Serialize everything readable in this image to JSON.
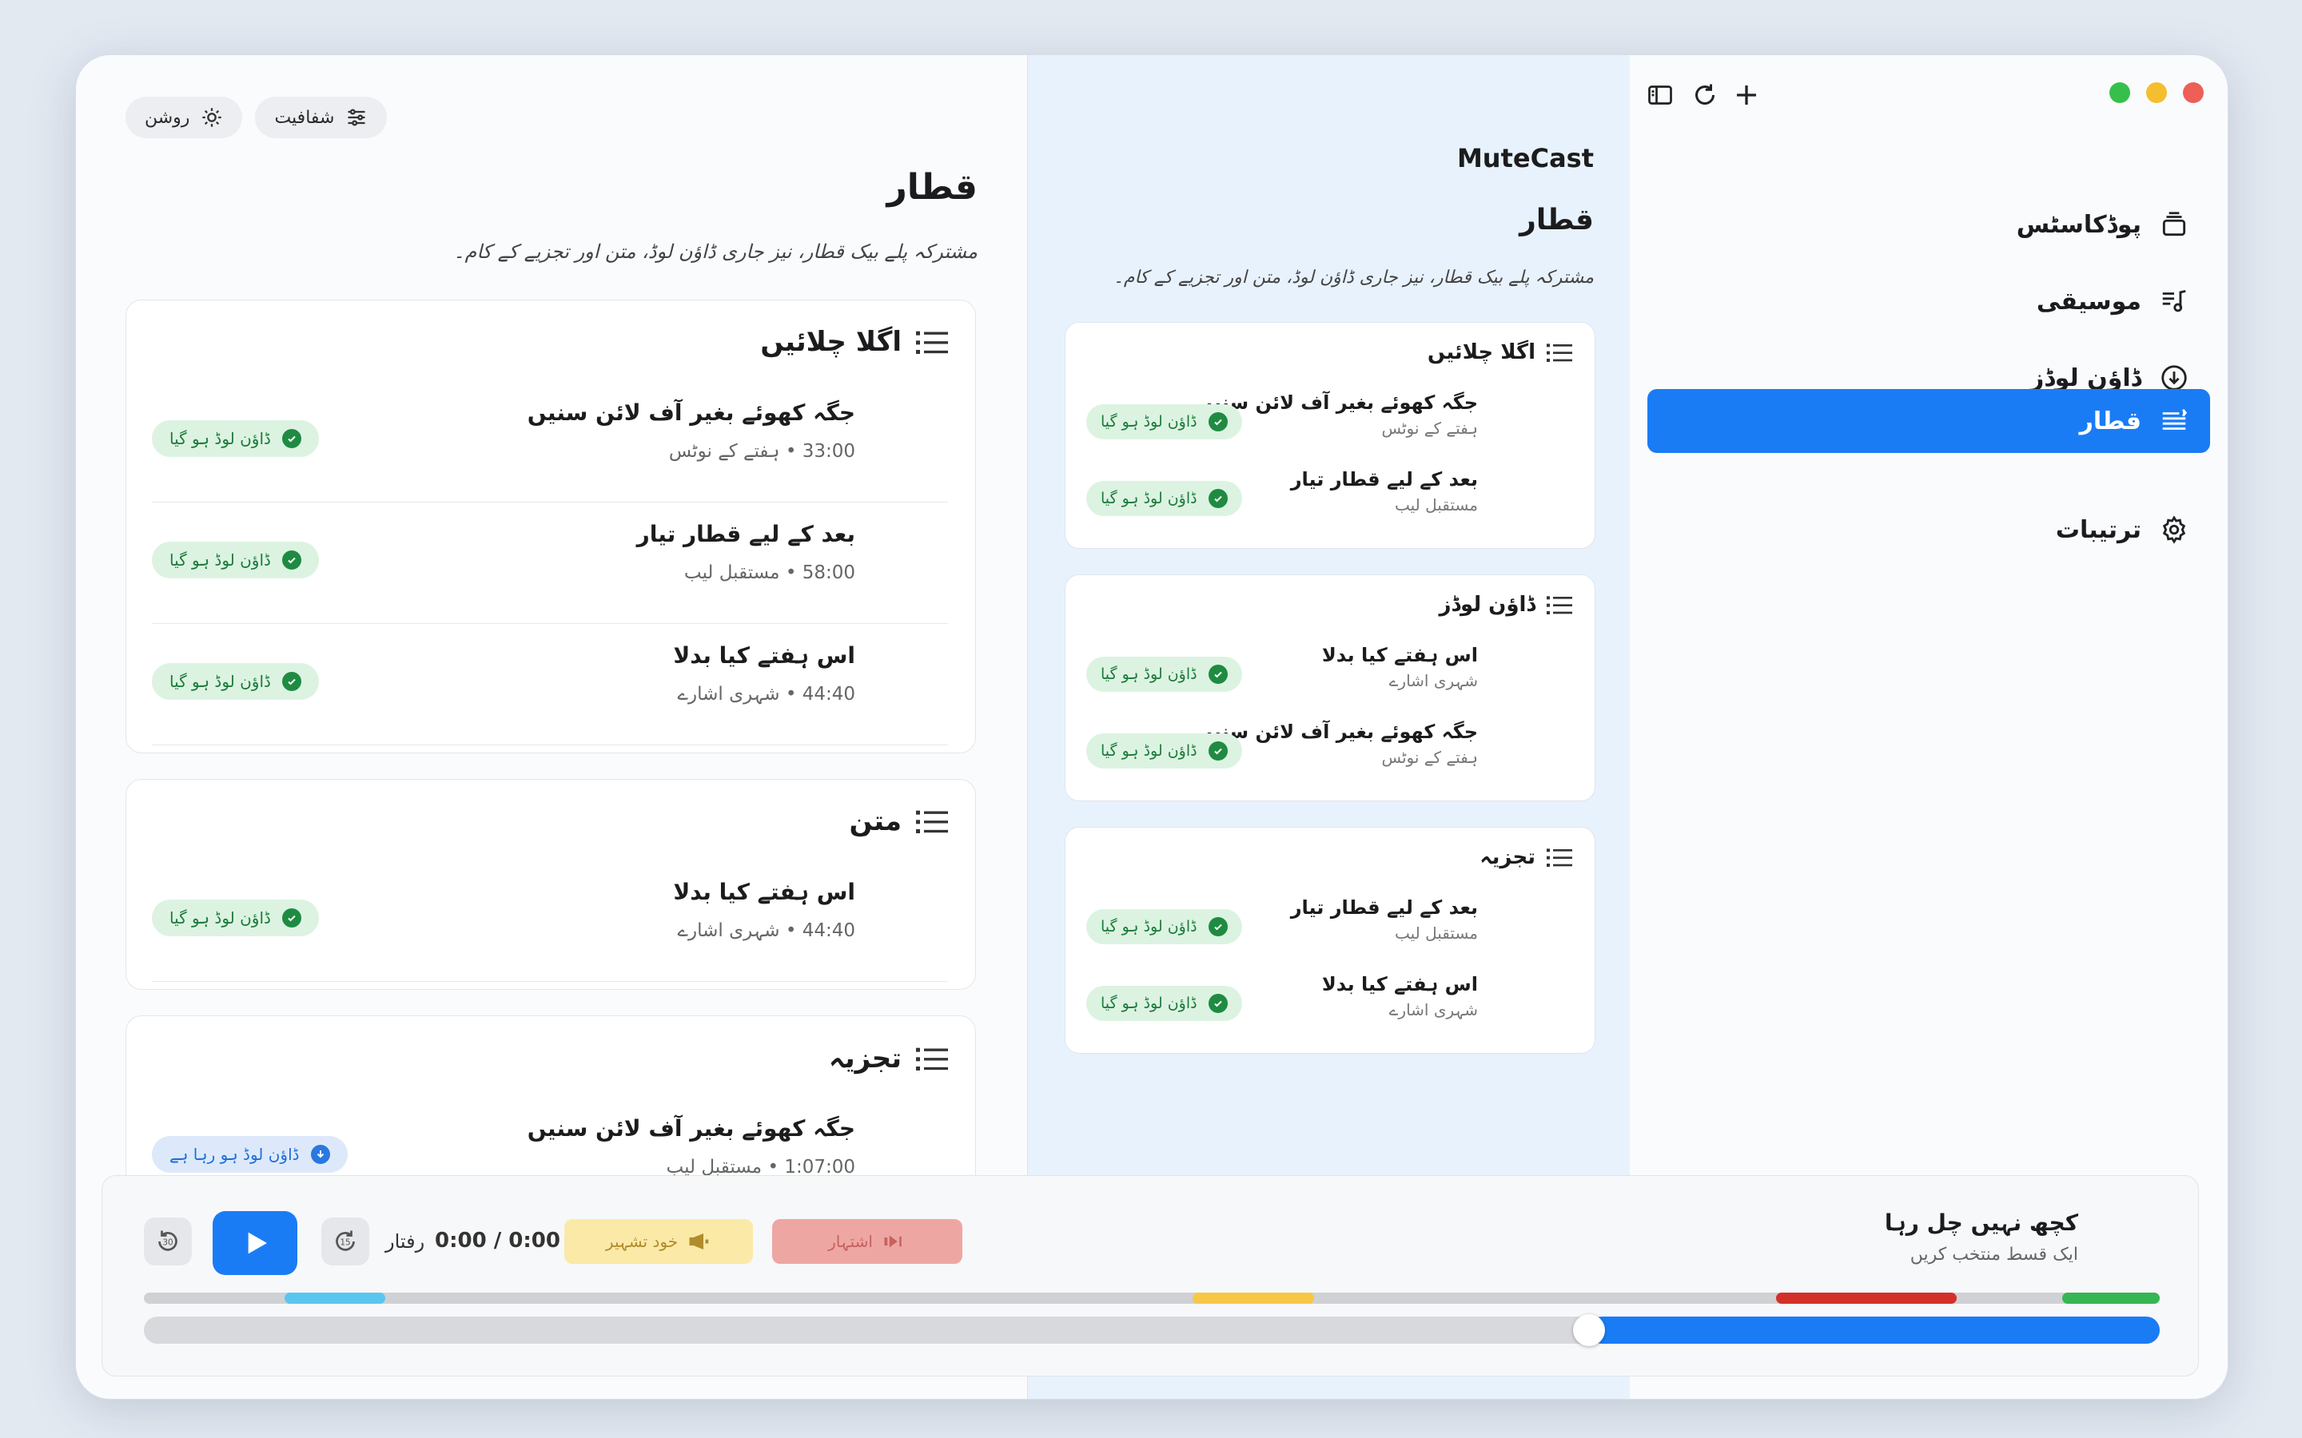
{
  "colors": {
    "accent": "#1a7cf5",
    "success": "#1f8b42",
    "success_bg": "#dcf3e2",
    "selfpromo": "#fbe9a8",
    "sponsor": "#eea6a3"
  },
  "toolbar": {
    "transparency_label": "شفافیت",
    "light_label": "روشن"
  },
  "main": {
    "title": "قطار",
    "description": "مشترکہ پلے بیک قطار، نیز جاری ڈاؤن لوڈ، متن اور تجزیے کے کام۔",
    "sections": [
      {
        "title": "اگلا چلائیں",
        "items": [
          {
            "title": "جگہ کھوئے بغیر آف لائن سنیں",
            "meta": "33:00 • ہفتے کے نوٹس",
            "status": "ڈاؤن لوڈ ہو گیا",
            "state": "done"
          },
          {
            "title": "بعد کے لیے قطار تیار",
            "meta": "58:00 • مستقبل لیب",
            "status": "ڈاؤن لوڈ ہو گیا",
            "state": "done"
          },
          {
            "title": "اس ہفتے کیا بدلا",
            "meta": "44:40 • شہری اشارے",
            "status": "ڈاؤن لوڈ ہو گیا",
            "state": "done"
          }
        ]
      },
      {
        "title": "متن",
        "items": [
          {
            "title": "اس ہفتے کیا بدلا",
            "meta": "44:40 • شہری اشارے",
            "status": "ڈاؤن لوڈ ہو گیا",
            "state": "done"
          }
        ]
      },
      {
        "title": "تجزیہ",
        "items": [
          {
            "title": "جگہ کھوئے بغیر آف لائن سنیں",
            "meta": "1:07:00 • مستقبل لیب",
            "status": "ڈاؤن لوڈ ہو رہا ہے",
            "state": "loading"
          }
        ]
      }
    ]
  },
  "preview": {
    "brand": "MuteCast",
    "title": "قطار",
    "description": "مشترکہ پلے بیک قطار، نیز جاری ڈاؤن لوڈ، متن اور تجزیے کے کام۔",
    "sections": [
      {
        "title": "اگلا چلائیں",
        "items": [
          {
            "title": "جگہ کھوئے بغیر آف لائن سنیں",
            "meta": "ہفتے کے نوٹس",
            "status": "ڈاؤن لوڈ ہو گیا"
          },
          {
            "title": "بعد کے لیے قطار تیار",
            "meta": "مستقبل لیب",
            "status": "ڈاؤن لوڈ ہو گیا"
          }
        ]
      },
      {
        "title": "ڈاؤن لوڈز",
        "items": [
          {
            "title": "اس ہفتے کیا بدلا",
            "meta": "شہری اشارے",
            "status": "ڈاؤن لوڈ ہو گیا"
          },
          {
            "title": "جگہ کھوئے بغیر آف لائن سنیں",
            "meta": "ہفتے کے نوٹس",
            "status": "ڈاؤن لوڈ ہو گیا"
          }
        ]
      },
      {
        "title": "تجزیہ",
        "items": [
          {
            "title": "بعد کے لیے قطار تیار",
            "meta": "مستقبل لیب",
            "status": "ڈاؤن لوڈ ہو گیا"
          },
          {
            "title": "اس ہفتے کیا بدلا",
            "meta": "شہری اشارے",
            "status": "ڈاؤن لوڈ ہو گیا"
          }
        ]
      }
    ]
  },
  "sidebar": {
    "items": [
      {
        "label": "پوڈکاسٹس",
        "icon": "podcast-stack-icon"
      },
      {
        "label": "موسیقی",
        "icon": "music-note-icon"
      },
      {
        "label": "ڈاؤن لوڈز",
        "icon": "download-circle-icon"
      },
      {
        "label": "قطار",
        "icon": "queue-list-icon",
        "active": true
      },
      {
        "label": "ترتیبات",
        "icon": "gear-icon"
      }
    ]
  },
  "player": {
    "speed_label": "رفتار",
    "time": "0:00 / 0:00",
    "skip_selfpromo": "خود تشہیر",
    "skip_sponsor": "اشتہار",
    "now_playing": "کچھ نہیں چل رہا",
    "now_playing_sub": "ایک قسط منتخب کریں",
    "progress_fraction": 0.717
  }
}
